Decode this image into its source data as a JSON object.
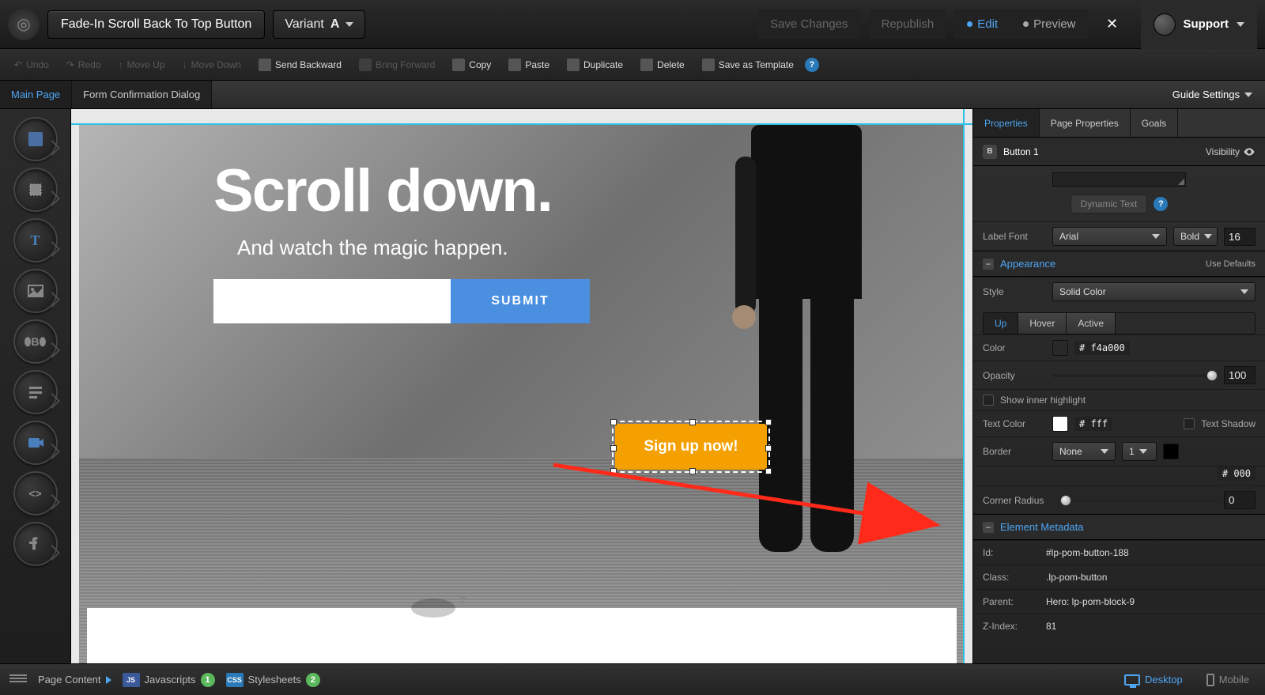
{
  "header": {
    "page_title": "Fade-In Scroll Back To Top Button",
    "variant_label": "Variant",
    "variant_value": "A",
    "save": "Save Changes",
    "republish": "Republish",
    "edit": "Edit",
    "preview": "Preview",
    "support": "Support"
  },
  "toolbar": {
    "undo": "Undo",
    "redo": "Redo",
    "move_up": "Move Up",
    "move_down": "Move Down",
    "send_backward": "Send Backward",
    "bring_forward": "Bring Forward",
    "copy": "Copy",
    "paste": "Paste",
    "duplicate": "Duplicate",
    "delete": "Delete",
    "save_template": "Save as Template"
  },
  "tabs": {
    "main_page": "Main Page",
    "form_confirm": "Form Confirmation Dialog",
    "guide_settings": "Guide Settings"
  },
  "canvas": {
    "headline": "Scroll down.",
    "subhead": "And watch the magic happen.",
    "submit": "SUBMIT",
    "cta": "Sign up now!"
  },
  "panel": {
    "tab_properties": "Properties",
    "tab_page_props": "Page Properties",
    "tab_goals": "Goals",
    "element_name": "Button 1",
    "visibility": "Visibility",
    "dynamic_text": "Dynamic Text",
    "label_font": "Label Font",
    "font_family": "Arial",
    "font_weight": "Bold",
    "font_size": "16",
    "appearance": "Appearance",
    "use_defaults": "Use Defaults",
    "style_label": "Style",
    "style_value": "Solid Color",
    "state_up": "Up",
    "state_hover": "Hover",
    "state_active": "Active",
    "color_label": "Color",
    "color_hex": "# f4a000",
    "color_swatch": "#f4a000",
    "opacity_label": "Opacity",
    "opacity_value": "100",
    "show_inner": "Show inner highlight",
    "text_color_label": "Text Color",
    "text_color_hex": "# fff",
    "text_color_swatch": "#ffffff",
    "text_shadow": "Text Shadow",
    "border_label": "Border",
    "border_style": "None",
    "border_width": "1",
    "border_swatch": "#000000",
    "border_hex": "# 000",
    "corner_label": "Corner Radius",
    "corner_value": "0",
    "metadata_title": "Element Metadata",
    "id_label": "Id:",
    "id_value": "#lp-pom-button-188",
    "class_label": "Class:",
    "class_value": ".lp-pom-button",
    "parent_label": "Parent:",
    "parent_value": "Hero: lp-pom-block-9",
    "zindex_label": "Z-Index:",
    "zindex_value": "81"
  },
  "bottom": {
    "page_content": "Page Content",
    "javascripts": "Javascripts",
    "js_count": "1",
    "stylesheets": "Stylesheets",
    "css_count": "2",
    "desktop": "Desktop",
    "mobile": "Mobile"
  }
}
